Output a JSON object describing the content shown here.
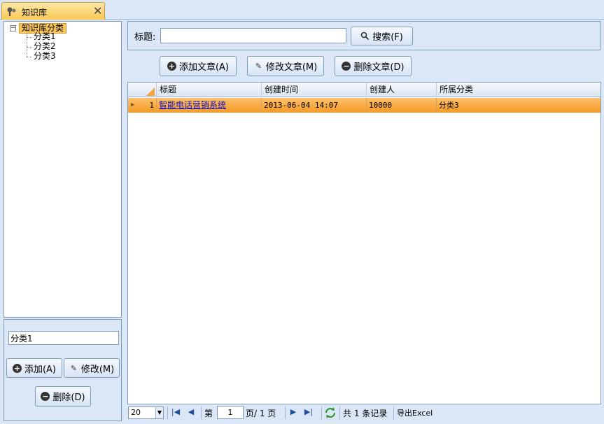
{
  "tab": {
    "label": "知识库",
    "close": "✕"
  },
  "tree": {
    "root": "知识库分类",
    "toggle": "−",
    "children": [
      "分类1",
      "分类2",
      "分类3"
    ]
  },
  "category_editor": {
    "value": "分类1",
    "add_label": "添加(A)",
    "edit_label": "修改(M)",
    "delete_label": "删除(D)"
  },
  "search": {
    "label": "标题:",
    "value": "",
    "button_label": "搜索(F)"
  },
  "toolbar": {
    "add_label": "添加文章(A)",
    "edit_label": "修改文章(M)",
    "delete_label": "删除文章(D)"
  },
  "grid": {
    "columns": [
      "标题",
      "创建时间",
      "创建人",
      "所属分类"
    ],
    "rows": [
      {
        "index": "1",
        "title": "智能电话营销系统",
        "created": "2013-06-04 14:07",
        "creator": "10000",
        "category": "分类3"
      }
    ]
  },
  "pager": {
    "page_size": "20",
    "page_prefix": "第",
    "page_value": "1",
    "page_suffix": "页/ 1 页",
    "total": "共 1 条记录",
    "export": "导出Excel"
  },
  "colors": {
    "accent": "#f8c64f",
    "selection": "#f59a26",
    "frame": "#dbe7f6",
    "border": "#7f9db9"
  }
}
